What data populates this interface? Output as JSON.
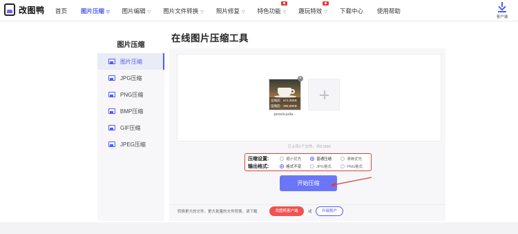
{
  "app": {
    "name": "改图鸭"
  },
  "nav": {
    "items": [
      {
        "label": "首页",
        "active": false,
        "dropdown": false,
        "badge": false
      },
      {
        "label": "图片压缩",
        "active": true,
        "dropdown": true,
        "badge": false
      },
      {
        "label": "图片编辑",
        "active": false,
        "dropdown": true,
        "badge": false
      },
      {
        "label": "图片文件转换",
        "active": false,
        "dropdown": true,
        "badge": false
      },
      {
        "label": "照片修复",
        "active": false,
        "dropdown": true,
        "badge": false
      },
      {
        "label": "特色功能",
        "active": false,
        "dropdown": true,
        "badge": true
      },
      {
        "label": "趣玩特效",
        "active": false,
        "dropdown": true,
        "badge": true
      },
      {
        "label": "下载中心",
        "active": false,
        "dropdown": false,
        "badge": false
      },
      {
        "label": "使用帮助",
        "active": false,
        "dropdown": false,
        "badge": false
      }
    ],
    "client_label": "客户端"
  },
  "sidebar": {
    "title": "图片压缩",
    "items": [
      {
        "label": "图片压缩",
        "active": true
      },
      {
        "label": "JPG压缩",
        "active": false
      },
      {
        "label": "PNG压缩",
        "active": false
      },
      {
        "label": "BMP压缩",
        "active": false
      },
      {
        "label": "GIF压缩",
        "active": false
      },
      {
        "label": "JPEG压缩",
        "active": false
      }
    ]
  },
  "main": {
    "title": "在线图片压缩工具",
    "file": {
      "name": "pexels-juliа...",
      "original_label": "压缩前：573.39KB",
      "compressed_label": "压缩后：286.69KB"
    },
    "upload_hint": "已上传1个文件，共0.56M",
    "settings": {
      "compress_label": "压缩设置:",
      "compress_options": [
        {
          "label": "缩小优先",
          "selected": false
        },
        {
          "label": "普通压缩",
          "selected": true
        },
        {
          "label": "清晰优先",
          "selected": false
        }
      ],
      "format_label": "输出格式:",
      "format_options": [
        {
          "label": "格式不变",
          "selected": true
        },
        {
          "label": "JPG格式",
          "selected": false
        },
        {
          "label": "PNG格式",
          "selected": false
        }
      ]
    },
    "start_button": "开始压缩",
    "bottom": {
      "text": "转换更大的文件、更大批量的文件转换，请下载",
      "client_button": "改图鸭客户端",
      "or": "或",
      "upgrade_button": "升级账户"
    }
  },
  "colors": {
    "accent": "#4f5bf7",
    "button": "#6b76f7",
    "highlight": "#e23b3b",
    "danger": "#ef5350"
  }
}
